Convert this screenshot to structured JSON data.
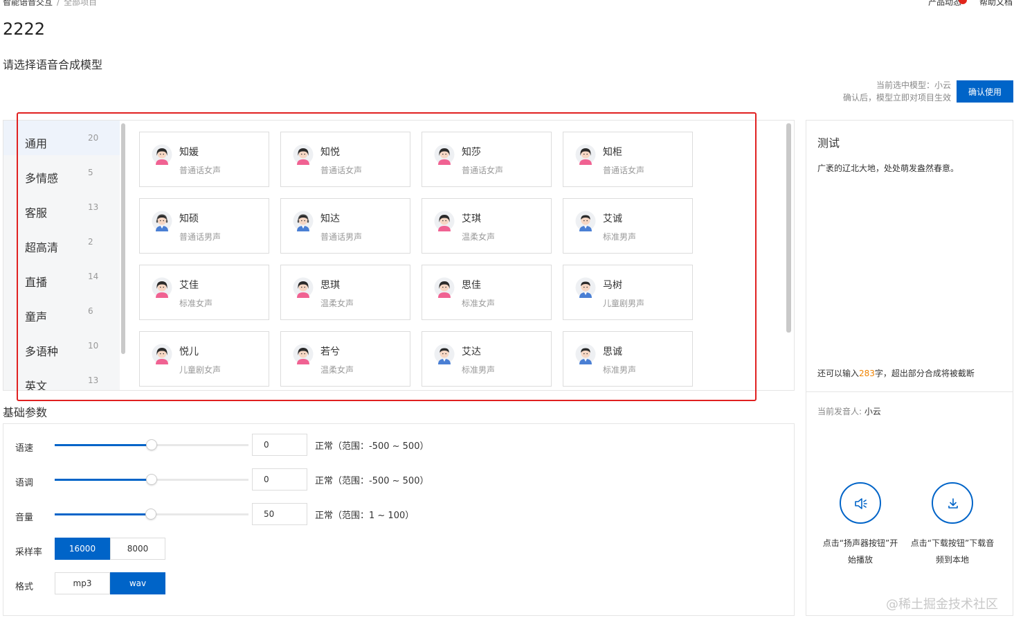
{
  "breadcrumb": {
    "root": "智能语音交互",
    "separator": "/",
    "current": "全部项目"
  },
  "top_links": {
    "news": "产品动态",
    "docs": "帮助文档"
  },
  "project": {
    "title": "2222"
  },
  "section": {
    "select_model": "请选择语音合成模型"
  },
  "confirm": {
    "current_model": "当前选中模型：小云",
    "note": "确认后，模型立即对项目生效",
    "button": "确认使用"
  },
  "categories": [
    {
      "label": "通用",
      "count": "20",
      "active": true
    },
    {
      "label": "多情感",
      "count": "5"
    },
    {
      "label": "客服",
      "count": "13"
    },
    {
      "label": "超高清",
      "count": "2"
    },
    {
      "label": "直播",
      "count": "14"
    },
    {
      "label": "童声",
      "count": "6"
    },
    {
      "label": "多语种",
      "count": "10"
    },
    {
      "label": "英文",
      "count": "13"
    }
  ],
  "voices": [
    {
      "name": "知媛",
      "desc": "普通话女声",
      "gender": "female"
    },
    {
      "name": "知悦",
      "desc": "普通话女声",
      "gender": "female"
    },
    {
      "name": "知莎",
      "desc": "普通话女声",
      "gender": "female"
    },
    {
      "name": "知柜",
      "desc": "普通话女声",
      "gender": "female"
    },
    {
      "name": "知硕",
      "desc": "普通话男声",
      "gender": "male-headset"
    },
    {
      "name": "知达",
      "desc": "普通话男声",
      "gender": "male-headset"
    },
    {
      "name": "艾琪",
      "desc": "温柔女声",
      "gender": "female"
    },
    {
      "name": "艾诚",
      "desc": "标准男声",
      "gender": "male"
    },
    {
      "name": "艾佳",
      "desc": "标准女声",
      "gender": "female"
    },
    {
      "name": "思琪",
      "desc": "温柔女声",
      "gender": "female"
    },
    {
      "name": "思佳",
      "desc": "标准女声",
      "gender": "female"
    },
    {
      "name": "马树",
      "desc": "儿童剧男声",
      "gender": "male"
    },
    {
      "name": "悦儿",
      "desc": "儿童剧女声",
      "gender": "female"
    },
    {
      "name": "若兮",
      "desc": "温柔女声",
      "gender": "female"
    },
    {
      "name": "艾达",
      "desc": "标准男声",
      "gender": "male"
    },
    {
      "name": "思诚",
      "desc": "标准男声",
      "gender": "male"
    }
  ],
  "params": {
    "title": "基础参数",
    "speed": {
      "label": "语速",
      "value": "0",
      "hint": "正常（范围：-500 ~ 500）",
      "min": -500,
      "max": 500
    },
    "pitch": {
      "label": "语调",
      "value": "0",
      "hint": "正常（范围：-500 ~ 500）",
      "min": -500,
      "max": 500
    },
    "volume": {
      "label": "音量",
      "value": "50",
      "hint": "正常（范围：1 ~ 100）",
      "min": 1,
      "max": 100
    },
    "sample_rate": {
      "label": "采样率",
      "options": [
        "16000",
        "8000"
      ],
      "selected": "16000"
    },
    "format": {
      "label": "格式",
      "options": [
        "mp3",
        "wav"
      ],
      "selected": "wav"
    }
  },
  "test": {
    "title": "测试",
    "text": "广袤的辽北大地，处处萌发盎然春意。",
    "remain_prefix": "还可以输入",
    "remain_count": "283",
    "remain_suffix": "字，超出部分合成将被截断",
    "speaker_label": "当前发音人: ",
    "speaker_name": "小云",
    "play_caption_1": "点击“扬声器按钮”开",
    "play_caption_2": "始播放",
    "download_caption_1": "点击“下载按钮”下载音",
    "download_caption_2": "频到本地"
  },
  "watermark": "@稀土掘金技术社区",
  "colors": {
    "primary": "#0064c8",
    "highlight": "#e02020",
    "count_accent": "#f08300"
  }
}
